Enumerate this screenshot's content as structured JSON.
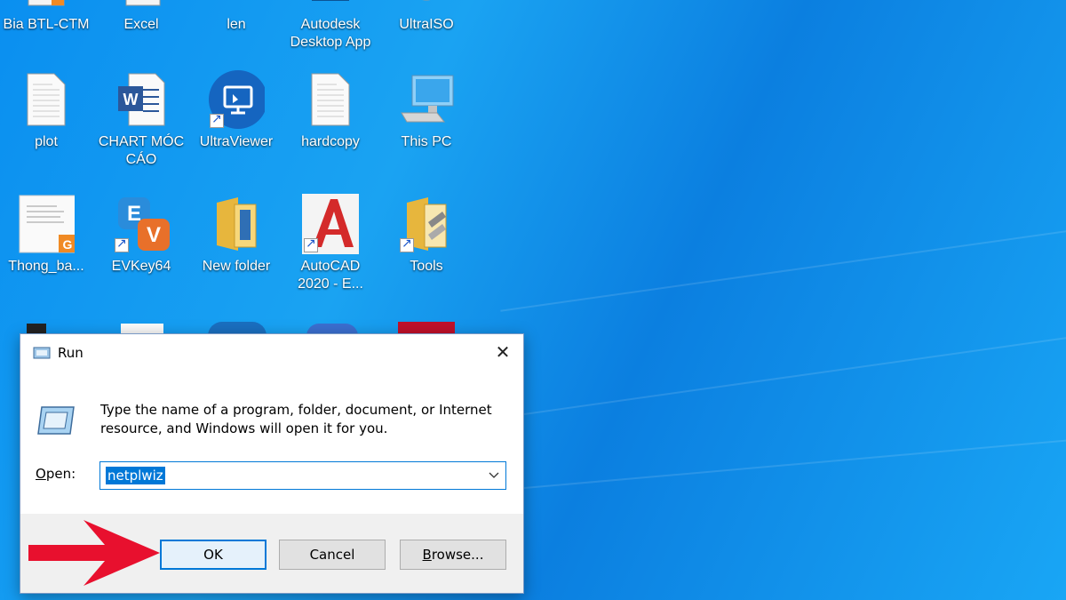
{
  "desktop": {
    "icons_row1": [
      "Bia BTL-CTM",
      "Excel",
      "len",
      "Autodesk Desktop App",
      "UltraISO"
    ],
    "icons_row2": [
      "plot",
      "CHART MÓC CÁO",
      "UltraViewer",
      "hardcopy",
      "This PC"
    ],
    "icons_row3": [
      "Thong_ba...",
      "EVKey64",
      "New folder",
      "AutoCAD 2020 - E...",
      "Tools"
    ],
    "icon_names": [
      "document-icon",
      "word-icon",
      "ultraviewer-icon",
      "document-icon",
      "computer-icon",
      "pdf-document-icon",
      "evkey-icon",
      "folder-icon",
      "autocad-icon",
      "folder-icon"
    ]
  },
  "run_dialog": {
    "title": "Run",
    "description": "Type the name of a program, folder, document, or Internet resource, and Windows will open it for you.",
    "open_label_letter": "O",
    "open_label_rest": "pen:",
    "open_value": "netplwiz",
    "buttons": {
      "ok": "OK",
      "cancel": "Cancel",
      "browse_letter": "B",
      "browse_rest": "rowse..."
    }
  },
  "colors": {
    "desktop_bg": "#0a8ff0",
    "accent": "#0078d7",
    "arrow": "#e8102e"
  }
}
